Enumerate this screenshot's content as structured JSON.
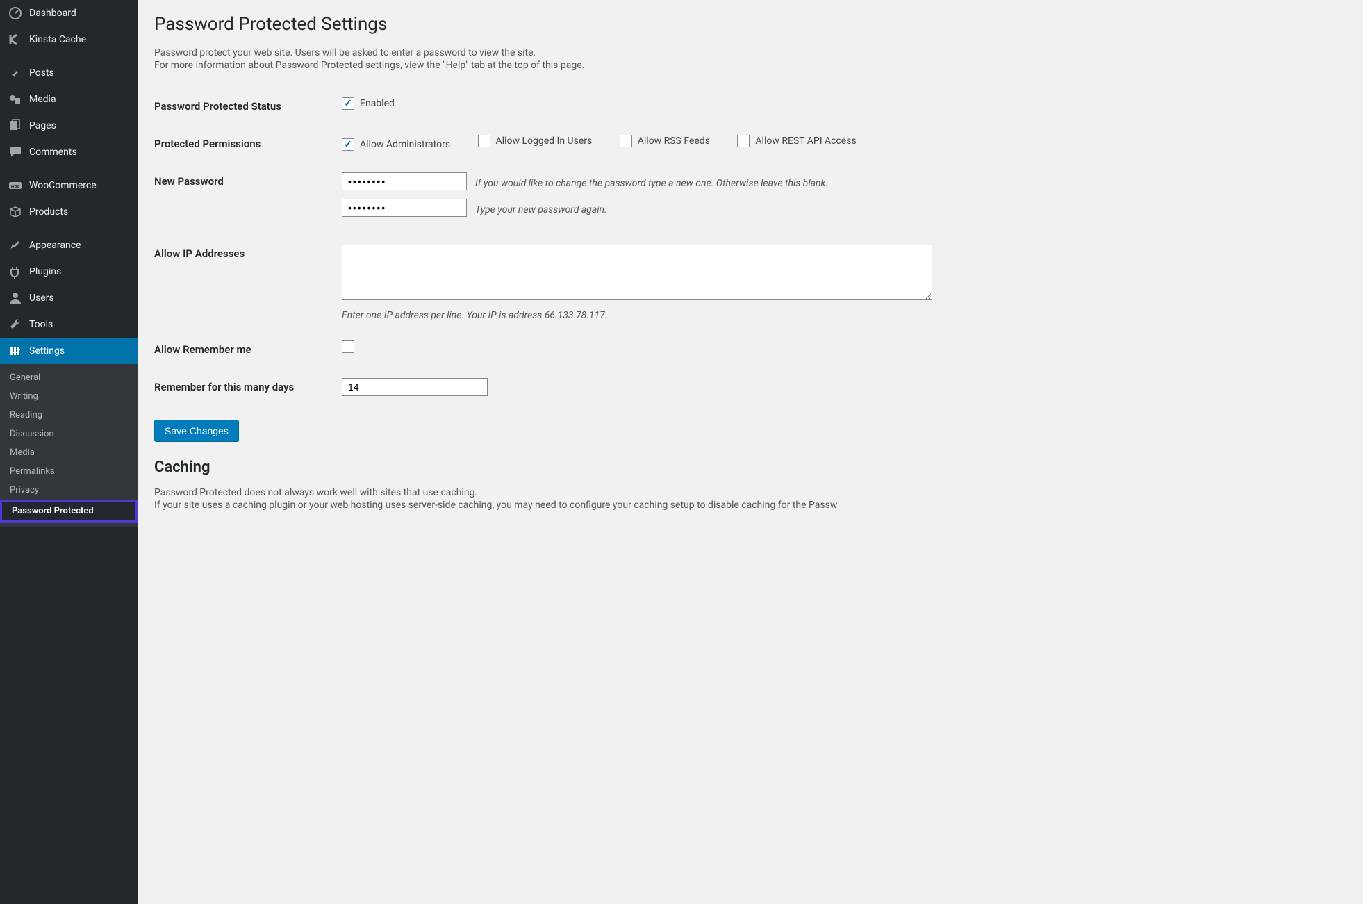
{
  "sidebar": {
    "items": [
      {
        "label": "Dashboard",
        "icon": "dashboard"
      },
      {
        "label": "Kinsta Cache",
        "icon": "kinsta"
      },
      {
        "label": "Posts",
        "icon": "pin"
      },
      {
        "label": "Media",
        "icon": "media"
      },
      {
        "label": "Pages",
        "icon": "pages"
      },
      {
        "label": "Comments",
        "icon": "comments"
      },
      {
        "label": "WooCommerce",
        "icon": "woo"
      },
      {
        "label": "Products",
        "icon": "products"
      },
      {
        "label": "Appearance",
        "icon": "appearance"
      },
      {
        "label": "Plugins",
        "icon": "plugins"
      },
      {
        "label": "Users",
        "icon": "users"
      },
      {
        "label": "Tools",
        "icon": "tools"
      },
      {
        "label": "Settings",
        "icon": "settings",
        "active": true
      }
    ],
    "sub": [
      {
        "label": "General"
      },
      {
        "label": "Writing"
      },
      {
        "label": "Reading"
      },
      {
        "label": "Discussion"
      },
      {
        "label": "Media"
      },
      {
        "label": "Permalinks"
      },
      {
        "label": "Privacy"
      },
      {
        "label": "Password Protected",
        "current": true
      }
    ]
  },
  "page": {
    "title": "Password Protected Settings",
    "desc1": "Password protect your web site. Users will be asked to enter a password to view the site.",
    "desc2": "For more information about Password Protected settings, view the \"Help\" tab at the top of this page."
  },
  "form": {
    "status_label": "Password Protected Status",
    "enabled_label": "Enabled",
    "permissions_label": "Protected Permissions",
    "perm_admin": "Allow Administrators",
    "perm_logged": "Allow Logged In Users",
    "perm_rss": "Allow RSS Feeds",
    "perm_rest": "Allow REST API Access",
    "new_password_label": "New Password",
    "pwd1_hint": "If you would like to change the password type a new one. Otherwise leave this blank.",
    "pwd2_hint": "Type your new password again.",
    "pwd_mask": "••••••••",
    "ip_label": "Allow IP Addresses",
    "ip_hint": "Enter one IP address per line. Your IP is address 66.133.78.117.",
    "remember_label": "Allow Remember me",
    "remember_days_label": "Remember for this many days",
    "remember_days_value": "14",
    "save_button": "Save Changes"
  },
  "caching": {
    "heading": "Caching",
    "line1": "Password Protected does not always work well with sites that use caching.",
    "line2": "If your site uses a caching plugin or your web hosting uses server-side caching, you may need to configure your caching setup to disable caching for the Passw"
  }
}
